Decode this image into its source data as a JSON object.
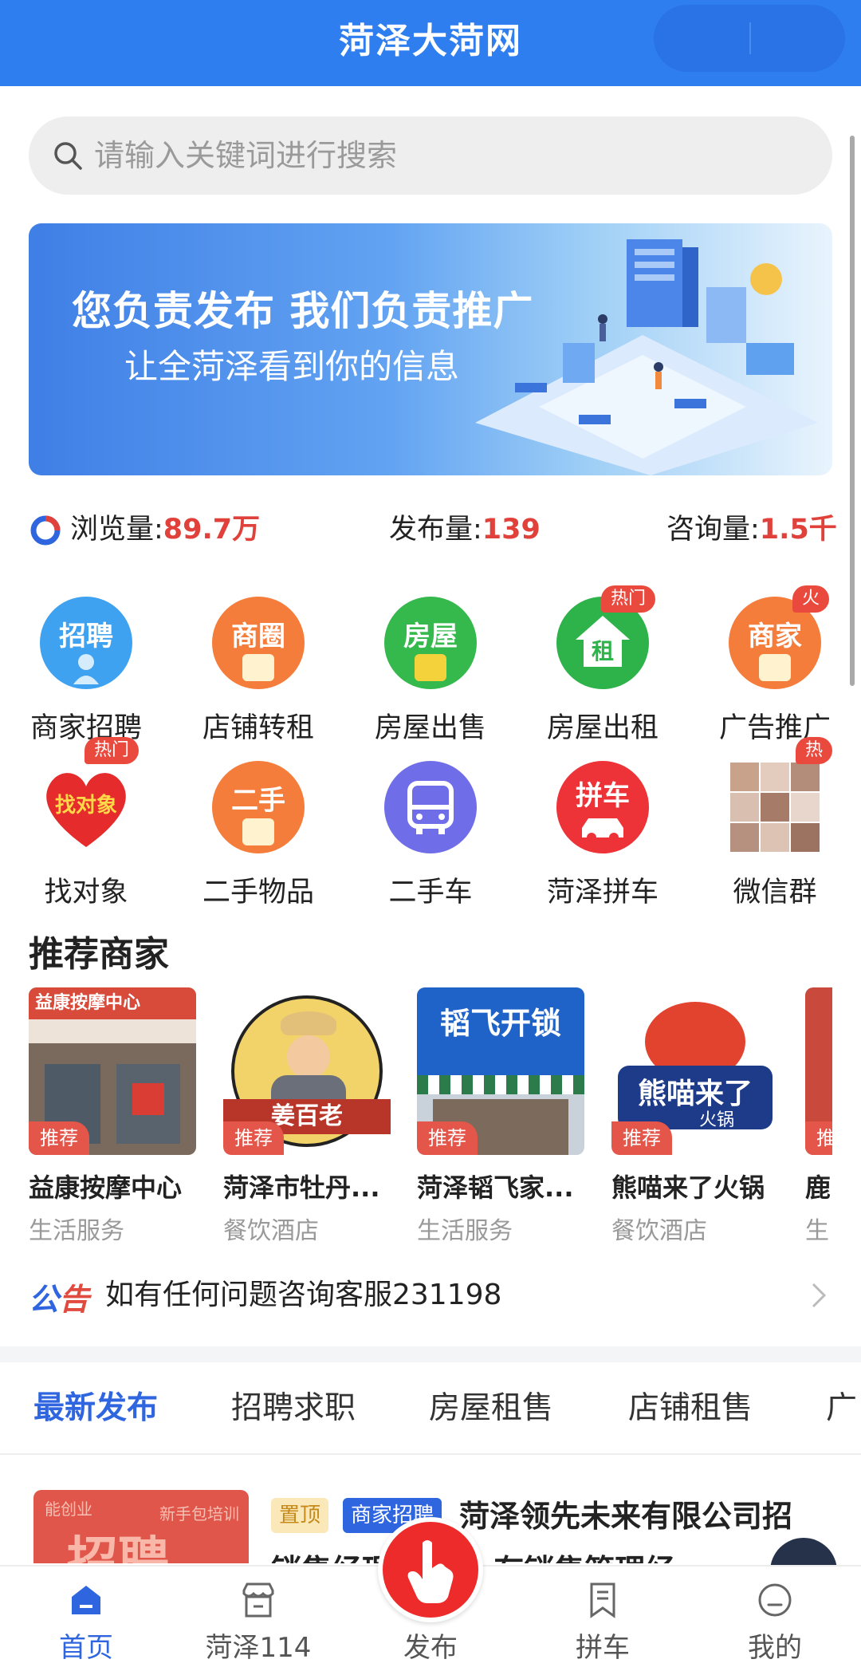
{
  "header": {
    "title": "菏泽大菏网"
  },
  "search": {
    "placeholder": "请输入关键词进行搜索"
  },
  "banner": {
    "title": "您负责发布 我们负责推广",
    "subtitle": "让全菏泽看到你的信息"
  },
  "stats": [
    {
      "label": "浏览量:",
      "value": "89.7万"
    },
    {
      "label": "发布量:",
      "value": "139"
    },
    {
      "label": "咨询量:",
      "value": "1.5千"
    }
  ],
  "categories": [
    {
      "label": "商家招聘",
      "icon_text": "招聘",
      "icon": "recruit-icon",
      "color": "#3ea2f0",
      "badge": ""
    },
    {
      "label": "店铺转租",
      "icon_text": "商圈",
      "icon": "store-icon",
      "color": "#f57d3c",
      "badge": ""
    },
    {
      "label": "房屋出售",
      "icon_text": "房屋",
      "icon": "house-icon",
      "color": "#35b84c",
      "badge": ""
    },
    {
      "label": "房屋出租",
      "icon_text": "租",
      "icon": "rent-house-icon",
      "color": "#2eb24a",
      "badge": "热门"
    },
    {
      "label": "广告推广",
      "icon_text": "商家",
      "icon": "merchant-icon",
      "color": "#f57d3c",
      "badge": "火"
    },
    {
      "label": "找对象",
      "icon_text": "找对象",
      "icon": "heart-icon",
      "color": "#e52b2b",
      "badge": "热门"
    },
    {
      "label": "二手物品",
      "icon_text": "二手",
      "icon": "secondhand-icon",
      "color": "#f57d3c",
      "badge": ""
    },
    {
      "label": "二手车",
      "icon_text": "",
      "icon": "bus-icon",
      "color": "#6f6ee8",
      "badge": ""
    },
    {
      "label": "菏泽拼车",
      "icon_text": "拼车",
      "icon": "carpool-icon",
      "color": "#ee3338",
      "badge": ""
    },
    {
      "label": "微信群",
      "icon_text": "",
      "icon": "photo-collage-icon",
      "color": "#d8c8c0",
      "badge": "热"
    }
  ],
  "recommended": {
    "title": "推荐商家",
    "tag": "推荐",
    "merchants": [
      {
        "name": "益康按摩中心",
        "category": "生活服务"
      },
      {
        "name": "菏泽市牡丹...",
        "category": "餐饮酒店"
      },
      {
        "name": "菏泽韬飞家...",
        "category": "生活服务"
      },
      {
        "name": "熊喵来了火锅",
        "category": "餐饮酒店"
      },
      {
        "name": "鹿",
        "category": "生"
      }
    ],
    "image_texts": {
      "m1": "益康按摩中心",
      "m2": "姜百老",
      "m3": "韬飞开锁",
      "m4": "熊喵来了",
      "m4_sub": "火锅"
    }
  },
  "notice": {
    "logo_a": "公",
    "logo_b": "告",
    "text": "如有任何问题咨询客服231198"
  },
  "tabs": [
    "最新发布",
    "招聘求职",
    "房屋租售",
    "店铺租售",
    "广"
  ],
  "listing": {
    "image_text": "招聘",
    "image_small_left": "能创业",
    "image_small_right": "新手包培训",
    "tag_top": "置顶",
    "tag_biz": "商家招聘",
    "title": "菏泽领先未来有限公司招",
    "desc": "销售经理 要求：有销售管理经"
  },
  "bottom_nav": [
    {
      "label": "首页",
      "icon": "home-icon"
    },
    {
      "label": "菏泽114",
      "icon": "shop-icon"
    },
    {
      "label": "发布",
      "icon": "tap-hand-icon"
    },
    {
      "label": "拼车",
      "icon": "bookmark-icon"
    },
    {
      "label": "我的",
      "icon": "profile-icon"
    }
  ],
  "colors": {
    "brand_blue": "#2f7ef0",
    "accent_red": "#e0413a",
    "active_blue": "#2f66e0"
  }
}
